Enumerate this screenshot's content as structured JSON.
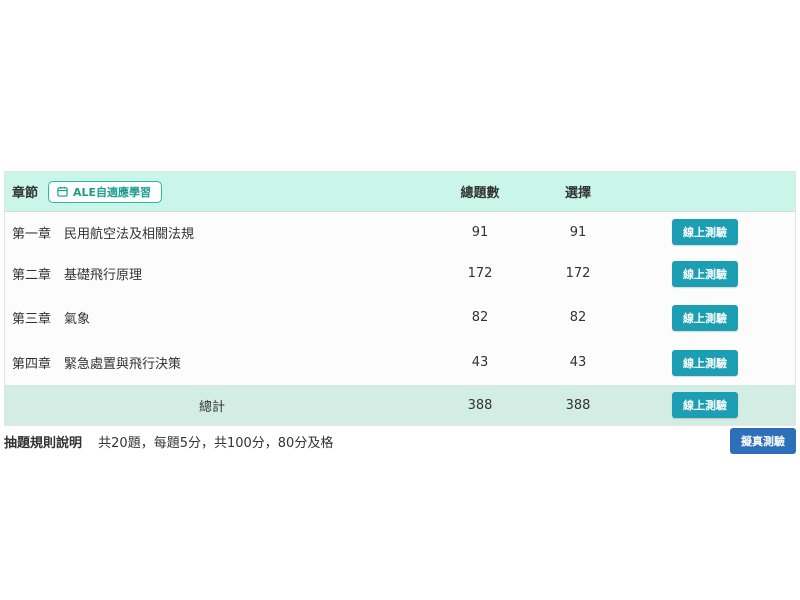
{
  "table": {
    "headers": {
      "chapter": "章節",
      "ale_button": "ALE自適應學習",
      "total_questions": "總題數",
      "choice": "選擇"
    },
    "rows": [
      {
        "chapter": "第一章　民用航空法及相關法規",
        "total": "91",
        "choice": "91",
        "action": "線上測驗"
      },
      {
        "chapter": "第二章　基礎飛行原理",
        "total": "172",
        "choice": "172",
        "action": "線上測驗"
      },
      {
        "chapter": "第三章　氣象",
        "total": "82",
        "choice": "82",
        "action": "線上測驗"
      },
      {
        "chapter": "第四章　緊急處置與飛行決策",
        "total": "43",
        "choice": "43",
        "action": "線上測驗"
      }
    ],
    "summary": {
      "label": "總計",
      "total": "388",
      "choice": "388",
      "action": "線上測驗"
    }
  },
  "footer": {
    "rules_label": "抽題規則說明",
    "rules_text": "共20題，每題5分，共100分，80分及格",
    "mock_exam": "擬真測驗"
  },
  "colors": {
    "header_bg": "#c9f6e8",
    "summary_bg": "#d4ede4",
    "quiz_button": "#1d9fb3",
    "mock_button": "#2d6fb8",
    "ale_accent": "#2bb7a7"
  },
  "icons": {
    "ale": "calendar-icon"
  }
}
